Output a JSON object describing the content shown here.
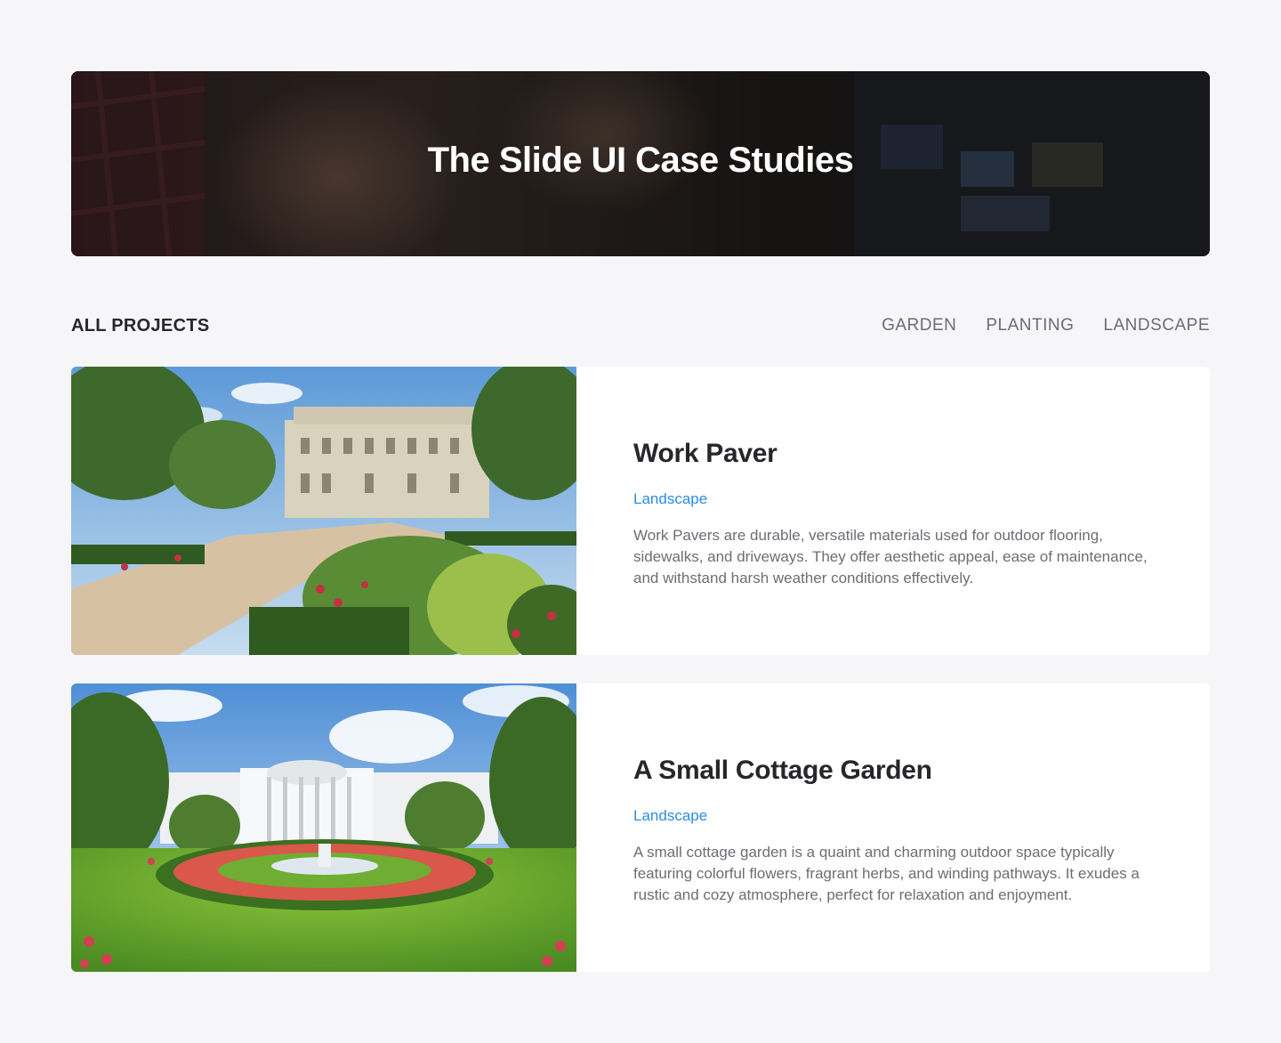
{
  "hero": {
    "title": "The Slide UI Case Studies"
  },
  "filter": {
    "all_label": "ALL PROJECTS",
    "tabs": [
      {
        "label": "GARDEN"
      },
      {
        "label": "PLANTING"
      },
      {
        "label": "LANDSCAPE"
      }
    ]
  },
  "projects": [
    {
      "title": "Work Paver",
      "tag": "Landscape",
      "description": "Work Pavers are durable, versatile materials used for outdoor flooring, sidewalks, and driveways. They offer aesthetic appeal, ease of maintenance, and withstand harsh weather conditions effectively."
    },
    {
      "title": "A Small Cottage Garden",
      "tag": "Landscape",
      "description": "A small cottage garden is a quaint and charming outdoor space typically featuring colorful flowers, fragrant herbs, and winding pathways. It exudes a rustic and cozy atmosphere, perfect for relaxation and enjoyment."
    }
  ],
  "colors": {
    "page_bg": "#f6f6f8",
    "accent": "#2d8de0",
    "heading": "#26272b",
    "body_text": "#6b6e74"
  }
}
